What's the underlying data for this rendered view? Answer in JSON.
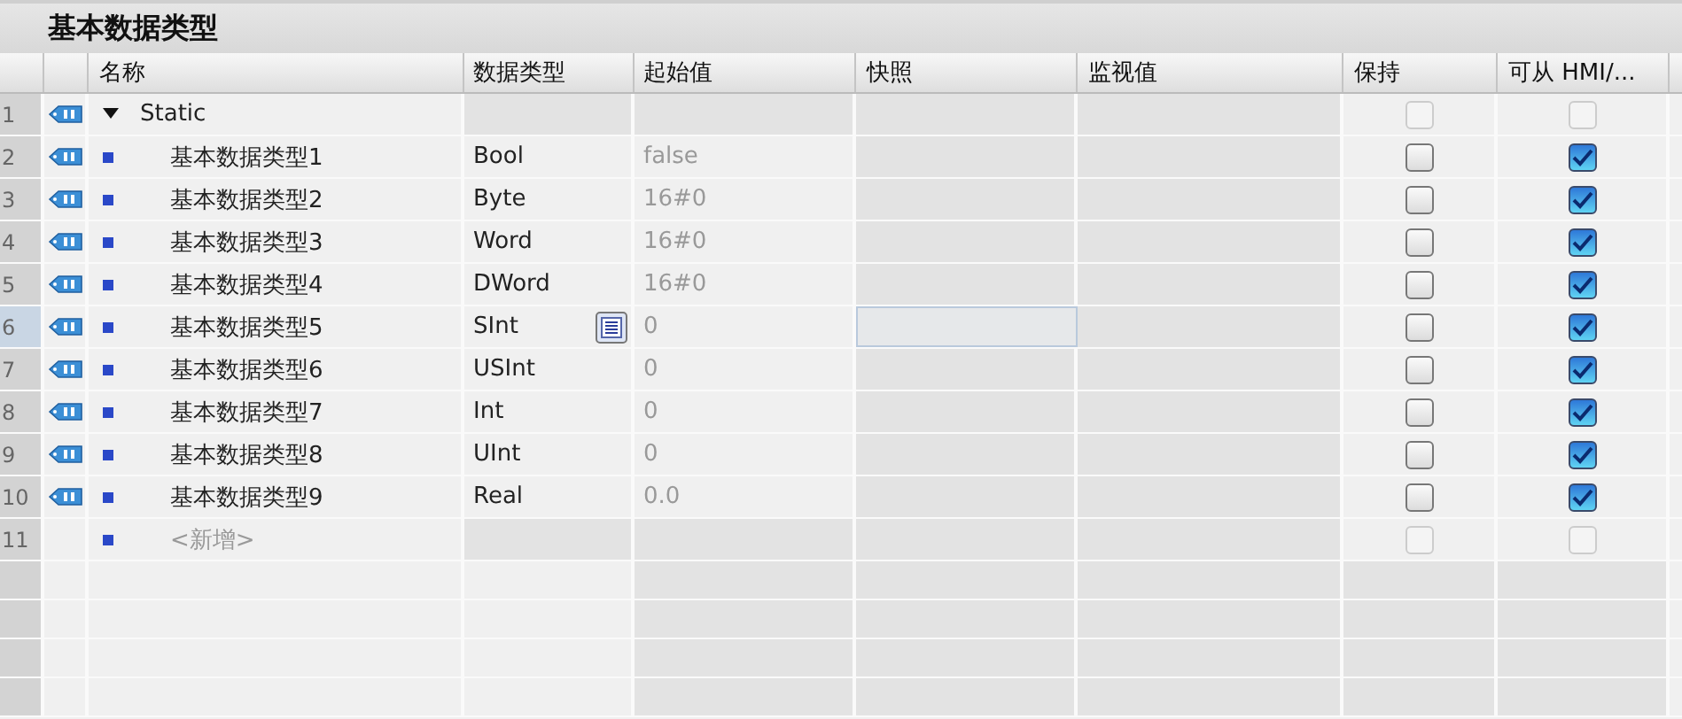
{
  "title": "基本数据类型",
  "columns": [
    "名称",
    "数据类型",
    "起始值",
    "快照",
    "监视值",
    "保持",
    "可从 HMI/..."
  ],
  "rows": [
    {
      "num": "1",
      "kind": "group",
      "expanded": true,
      "name": "Static",
      "type": "",
      "start": "",
      "selected": false,
      "retain": {
        "checked": false,
        "disabled": true
      },
      "hmi": {
        "checked": false,
        "disabled": true
      }
    },
    {
      "num": "2",
      "kind": "member",
      "name": "基本数据类型1",
      "type": "Bool",
      "start": "false",
      "selected": false,
      "retain": {
        "checked": false,
        "disabled": false
      },
      "hmi": {
        "checked": true,
        "disabled": false
      }
    },
    {
      "num": "3",
      "kind": "member",
      "name": "基本数据类型2",
      "type": "Byte",
      "start": "16#0",
      "selected": false,
      "retain": {
        "checked": false,
        "disabled": false
      },
      "hmi": {
        "checked": true,
        "disabled": false
      }
    },
    {
      "num": "4",
      "kind": "member",
      "name": "基本数据类型3",
      "type": "Word",
      "start": "16#0",
      "selected": false,
      "retain": {
        "checked": false,
        "disabled": false
      },
      "hmi": {
        "checked": true,
        "disabled": false
      }
    },
    {
      "num": "5",
      "kind": "member",
      "name": "基本数据类型4",
      "type": "DWord",
      "start": "16#0",
      "selected": false,
      "retain": {
        "checked": false,
        "disabled": false
      },
      "hmi": {
        "checked": true,
        "disabled": false
      }
    },
    {
      "num": "6",
      "kind": "member",
      "name": "基本数据类型5",
      "type": "SInt",
      "start": "0",
      "selected": true,
      "retain": {
        "checked": false,
        "disabled": false
      },
      "hmi": {
        "checked": true,
        "disabled": false
      }
    },
    {
      "num": "7",
      "kind": "member",
      "name": "基本数据类型6",
      "type": "USInt",
      "start": "0",
      "selected": false,
      "retain": {
        "checked": false,
        "disabled": false
      },
      "hmi": {
        "checked": true,
        "disabled": false
      }
    },
    {
      "num": "8",
      "kind": "member",
      "name": "基本数据类型7",
      "type": "Int",
      "start": "0",
      "selected": false,
      "retain": {
        "checked": false,
        "disabled": false
      },
      "hmi": {
        "checked": true,
        "disabled": false
      }
    },
    {
      "num": "9",
      "kind": "member",
      "name": "基本数据类型8",
      "type": "UInt",
      "start": "0",
      "selected": false,
      "retain": {
        "checked": false,
        "disabled": false
      },
      "hmi": {
        "checked": true,
        "disabled": false
      }
    },
    {
      "num": "10",
      "kind": "member",
      "name": "基本数据类型9",
      "type": "Real",
      "start": "0.0",
      "selected": false,
      "retain": {
        "checked": false,
        "disabled": false
      },
      "hmi": {
        "checked": true,
        "disabled": false
      }
    },
    {
      "num": "11",
      "kind": "add",
      "name": "<新增>",
      "type": "",
      "start": "",
      "selected": false,
      "retain": {
        "checked": false,
        "disabled": true
      },
      "hmi": {
        "checked": false,
        "disabled": true
      }
    }
  ]
}
